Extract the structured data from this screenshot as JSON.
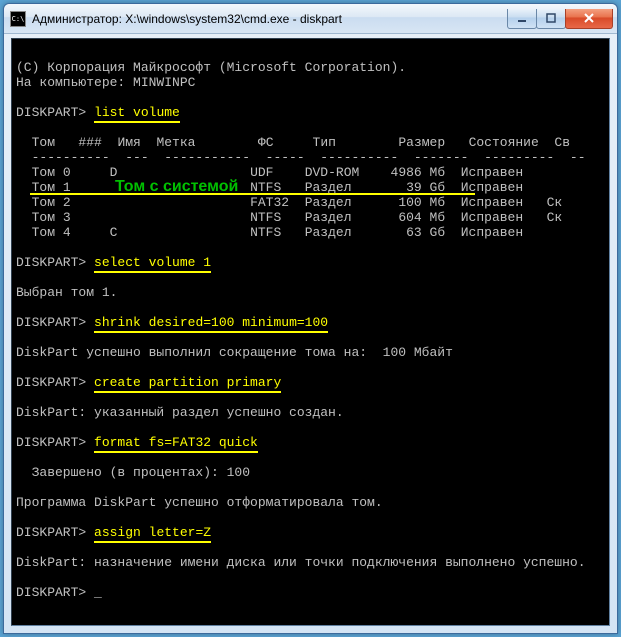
{
  "titlebar": {
    "icon_label": "C:\\",
    "title": "Администратор: X:\\windows\\system32\\cmd.exe - diskpart"
  },
  "console": {
    "copyright": "(C) Корпорация Майкрософт (Microsoft Corporation).",
    "host_line": "На компьютере: MINWINPC",
    "prompt": "DISKPART>",
    "cmd_list_volume": "list volume",
    "headers": {
      "col1": "Том",
      "col2": "###",
      "col3": "Имя",
      "col4": "Метка",
      "col5": "ФС",
      "col6": "Тип",
      "col7": "Размер",
      "col8": "Состояние",
      "col9": "Св"
    },
    "rows": [
      {
        "tom": "Том 0",
        "name": "D",
        "label": "",
        "fs": "UDF",
        "type": "DVD-ROM",
        "size": "4986 Мб",
        "state": "Исправен",
        "sv": ""
      },
      {
        "tom": "Том 1",
        "name": "",
        "label": "",
        "fs": "NTFS",
        "type": "Раздел",
        "size": "39 Gб",
        "state": "Исправен",
        "sv": ""
      },
      {
        "tom": "Том 2",
        "name": "",
        "label": "",
        "fs": "FAT32",
        "type": "Раздел",
        "size": "100 Мб",
        "state": "Исправен",
        "sv": "Ск"
      },
      {
        "tom": "Том 3",
        "name": "",
        "label": "",
        "fs": "NTFS",
        "type": "Раздел",
        "size": "604 Мб",
        "state": "Исправен",
        "sv": "Ск"
      },
      {
        "tom": "Том 4",
        "name": "C",
        "label": "",
        "fs": "NTFS",
        "type": "Раздел",
        "size": "63 Gб",
        "state": "Исправен",
        "sv": ""
      }
    ],
    "annot_system": "Том с системой",
    "cmd_select": "select volume 1",
    "resp_select": "Выбран том 1.",
    "cmd_shrink": "shrink desired=100 minimum=100",
    "resp_shrink": "DiskPart успешно выполнил сокращение тома на:  100 Мбайт",
    "cmd_create": "create partition primary",
    "resp_create": "DiskPart: указанный раздел успешно создан.",
    "cmd_format": "format fs=FAT32 quick",
    "resp_format_prog": "  Завершено (в процентах): 100",
    "resp_format_done": "Программа DiskPart успешно отформатировала том.",
    "cmd_assign": "assign letter=Z",
    "resp_assign": "DiskPart: назначение имени диска или точки подключения выполнено успешно.",
    "cursor": "_"
  }
}
